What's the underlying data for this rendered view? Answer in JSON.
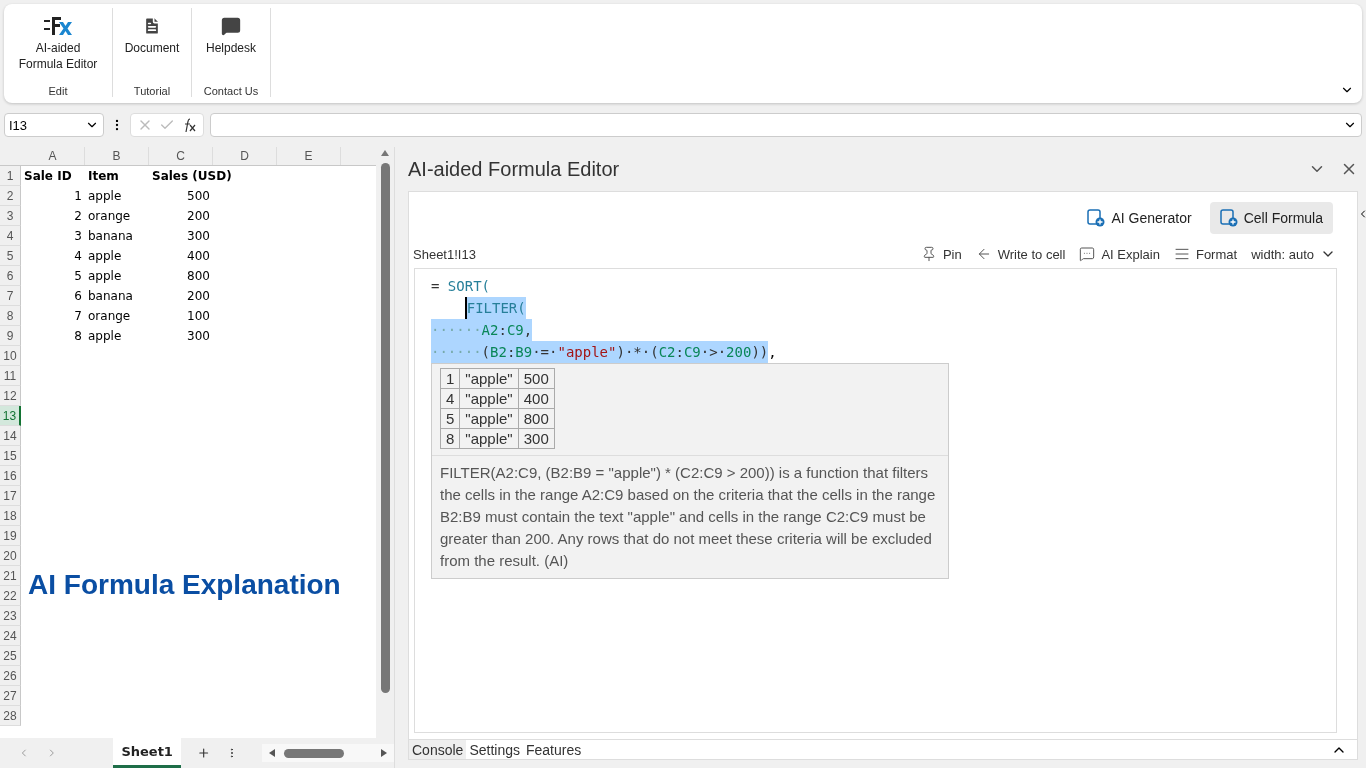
{
  "ribbon": {
    "groups": [
      {
        "label": "Edit",
        "buttons": [
          {
            "label": "AI-aided Formula Editor",
            "kind": "fx"
          }
        ]
      },
      {
        "label": "Tutorial",
        "buttons": [
          {
            "label": "Document",
            "kind": "doc"
          }
        ]
      },
      {
        "label": "Contact Us",
        "buttons": [
          {
            "label": "Helpdesk",
            "kind": "chat"
          }
        ]
      }
    ]
  },
  "formula_bar": {
    "name_box": "I13"
  },
  "sheet": {
    "columns": [
      "A",
      "B",
      "C",
      "D",
      "E"
    ],
    "rows": [
      {
        "number": "1",
        "selected": false,
        "cells": [
          {
            "text": "Sale ID",
            "kind": "header"
          },
          {
            "text": "Item",
            "kind": "header"
          },
          {
            "text": "Sales (USD)",
            "kind": "header"
          }
        ]
      },
      {
        "number": "2",
        "selected": false,
        "cells": [
          {
            "text": "1",
            "kind": "number"
          },
          {
            "text": "apple",
            "kind": "text"
          },
          {
            "text": "500",
            "kind": "number"
          }
        ]
      },
      {
        "number": "3",
        "selected": false,
        "cells": [
          {
            "text": "2",
            "kind": "number"
          },
          {
            "text": "orange",
            "kind": "text"
          },
          {
            "text": "200",
            "kind": "number"
          }
        ]
      },
      {
        "number": "4",
        "selected": false,
        "cells": [
          {
            "text": "3",
            "kind": "number"
          },
          {
            "text": "banana",
            "kind": "text"
          },
          {
            "text": "300",
            "kind": "number"
          }
        ]
      },
      {
        "number": "5",
        "selected": false,
        "cells": [
          {
            "text": "4",
            "kind": "number"
          },
          {
            "text": "apple",
            "kind": "text"
          },
          {
            "text": "400",
            "kind": "number"
          }
        ]
      },
      {
        "number": "6",
        "selected": false,
        "cells": [
          {
            "text": "5",
            "kind": "number"
          },
          {
            "text": "apple",
            "kind": "text"
          },
          {
            "text": "800",
            "kind": "number"
          }
        ]
      },
      {
        "number": "7",
        "selected": false,
        "cells": [
          {
            "text": "6",
            "kind": "number"
          },
          {
            "text": "banana",
            "kind": "text"
          },
          {
            "text": "200",
            "kind": "number"
          }
        ]
      },
      {
        "number": "8",
        "selected": false,
        "cells": [
          {
            "text": "7",
            "kind": "number"
          },
          {
            "text": "orange",
            "kind": "text"
          },
          {
            "text": "100",
            "kind": "number"
          }
        ]
      },
      {
        "number": "9",
        "selected": false,
        "cells": [
          {
            "text": "8",
            "kind": "number"
          },
          {
            "text": "apple",
            "kind": "text"
          },
          {
            "text": "300",
            "kind": "number"
          }
        ]
      },
      {
        "number": "10",
        "selected": false
      },
      {
        "number": "11",
        "selected": false
      },
      {
        "number": "12",
        "selected": false
      },
      {
        "number": "13",
        "selected": true
      },
      {
        "number": "14",
        "selected": false
      },
      {
        "number": "15",
        "selected": false
      },
      {
        "number": "16",
        "selected": false
      },
      {
        "number": "17",
        "selected": false
      },
      {
        "number": "18",
        "selected": false
      },
      {
        "number": "19",
        "selected": false
      },
      {
        "number": "20",
        "selected": false
      },
      {
        "number": "21",
        "selected": false
      },
      {
        "number": "22",
        "selected": false
      },
      {
        "number": "23",
        "selected": false
      },
      {
        "number": "24",
        "selected": false
      },
      {
        "number": "25",
        "selected": false
      },
      {
        "number": "26",
        "selected": false
      },
      {
        "number": "27",
        "selected": false
      },
      {
        "number": "28",
        "selected": false
      }
    ],
    "overlay_title": "AI Formula Explanation",
    "tabs": [
      {
        "label": "Sheet1",
        "selected": true
      }
    ]
  },
  "pane": {
    "title": "AI-aided Formula Editor",
    "modes": [
      {
        "label": "AI Generator",
        "selected": false
      },
      {
        "label": "Cell Formula",
        "selected": true
      }
    ],
    "cell_ref": "Sheet1!I13",
    "actions": [
      {
        "label": "Pin",
        "kind": "pin"
      },
      {
        "label": "Write to cell",
        "kind": "write"
      },
      {
        "label": "AI Explain",
        "kind": "explain"
      },
      {
        "label": "Format",
        "kind": "format"
      }
    ],
    "width_select": "width: auto",
    "code": [
      {
        "selected": false,
        "tokens": [
          {
            "text": "= ",
            "kind": "op"
          },
          {
            "text": "SORT(",
            "kind": "fn"
          }
        ]
      },
      {
        "selected": true,
        "cursor": true,
        "tokens": [
          {
            "text": "FILTER(",
            "kind": "fn"
          }
        ]
      },
      {
        "selected": true,
        "tokens": [
          {
            "text": "······",
            "kind": "ws"
          },
          {
            "text": "A2",
            "kind": "ref"
          },
          {
            "text": ":",
            "kind": "op"
          },
          {
            "text": "C9",
            "kind": "ref"
          },
          {
            "text": ",",
            "kind": "op"
          }
        ]
      },
      {
        "selected": true,
        "tokens": [
          {
            "text": "······",
            "kind": "ws"
          },
          {
            "text": "(",
            "kind": "op"
          },
          {
            "text": "B2",
            "kind": "ref"
          },
          {
            "text": ":",
            "kind": "op"
          },
          {
            "text": "B9",
            "kind": "ref"
          },
          {
            "text": "·=·",
            "kind": "op"
          },
          {
            "text": "\"apple\"",
            "kind": "str"
          },
          {
            "text": ")·*·(",
            "kind": "op"
          },
          {
            "text": "C2",
            "kind": "ref"
          },
          {
            "text": ":",
            "kind": "op"
          },
          {
            "text": "C9",
            "kind": "ref"
          },
          {
            "text": "·>·",
            "kind": "op"
          },
          {
            "text": "200",
            "kind": "num"
          },
          {
            "text": "))",
            "kind": "op"
          }
        ],
        "trail": ","
      }
    ],
    "result": {
      "rows": [
        [
          "1",
          "\"apple\"",
          "500"
        ],
        [
          "4",
          "\"apple\"",
          "400"
        ],
        [
          "5",
          "\"apple\"",
          "800"
        ],
        [
          "8",
          "\"apple\"",
          "300"
        ]
      ],
      "explanation": "FILTER(A2:C9, (B2:B9 = \"apple\") * (C2:C9 > 200)) is a function that filters the cells in the range A2:C9 based on the criteria that the cells in the range B2:B9 must contain the text \"apple\" and cells in the range C2:C9 must be greater than 200. Any rows that do not meet these criteria will be excluded from the result. (AI)"
    },
    "bottom_tabs": [
      {
        "label": "Console",
        "selected": true
      },
      {
        "label": "Settings",
        "selected": false
      },
      {
        "label": "Features",
        "selected": false
      }
    ]
  }
}
